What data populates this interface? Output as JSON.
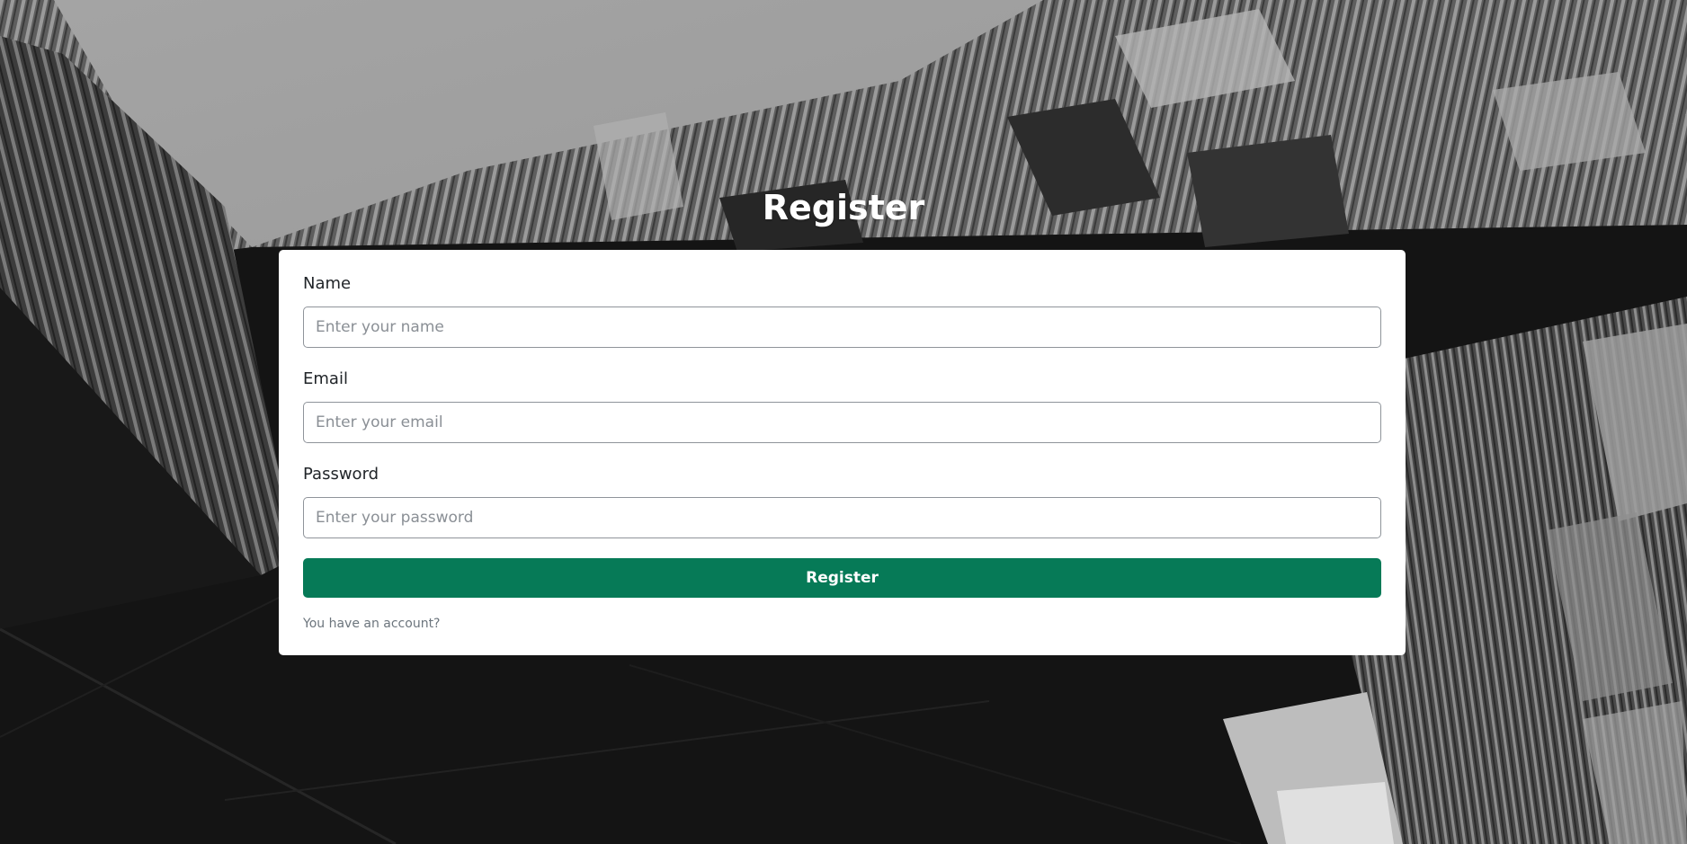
{
  "page": {
    "title": "Register"
  },
  "form": {
    "name": {
      "label": "Name",
      "placeholder": "Enter your name",
      "value": ""
    },
    "email": {
      "label": "Email",
      "placeholder": "Enter your email",
      "value": ""
    },
    "password": {
      "label": "Password",
      "placeholder": "Enter your password",
      "value": ""
    },
    "submit_label": "Register",
    "account_link": "You have an account?"
  },
  "colors": {
    "primary_button": "#067a57",
    "card_background": "#ffffff",
    "title_text": "#ffffff",
    "muted_text": "#6c757d"
  },
  "background": {
    "image": "black-and-white-building-facade-photo"
  }
}
